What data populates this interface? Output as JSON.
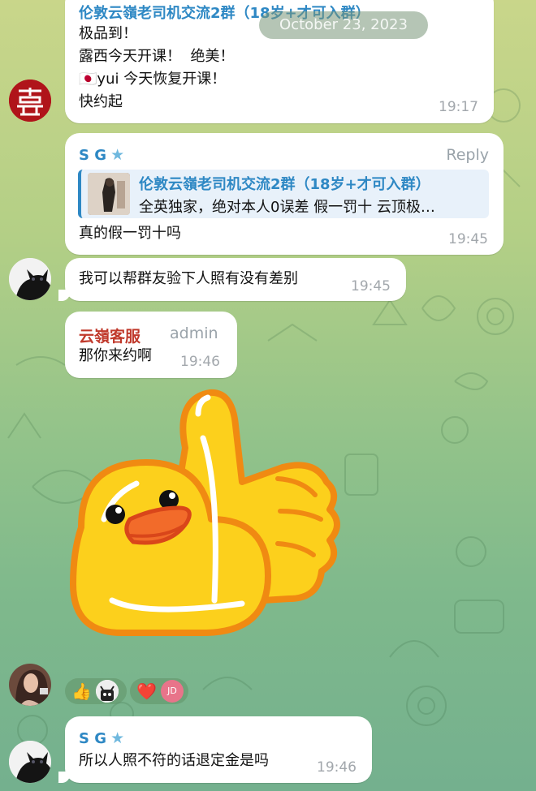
{
  "date_pill": "October 23, 2023",
  "messages": {
    "m1": {
      "sender": "伦敦云嶺老司机交流2群（18岁+才可入群）",
      "lines": [
        "极品到！",
        "露西今天开课！  绝美！",
        "yui 今天恢复开课！",
        "快约起"
      ],
      "flag": "🇯🇵",
      "time": "19:17"
    },
    "m2": {
      "sender": "S G",
      "reply_label": "Reply",
      "quote_title": "伦敦云嶺老司机交流2群（18岁+才可入群）",
      "quote_text": "全英独家，绝对本人0误差 假一罚十 云顶极…",
      "text": "真的假一罚十吗",
      "time": "19:45"
    },
    "m3": {
      "text": "我可以帮群友验下人照有没有差别",
      "time": "19:45"
    },
    "m4": {
      "sender": "云嶺客服",
      "role": "admin",
      "text": "那你来约啊",
      "time": "19:46"
    },
    "m5": {
      "sticker": "duck-thumbs-up",
      "reactions": [
        {
          "emoji": "👍",
          "users": [
            "robot-avatar"
          ]
        },
        {
          "emoji": "❤️",
          "users": [
            "JD"
          ]
        }
      ]
    },
    "m6": {
      "sender": "S G",
      "text": "所以人照不符的话退定金是吗",
      "time": "19:46"
    }
  },
  "colors": {
    "sender_blue": "#2e88c4",
    "admin_red": "#c0392b",
    "time_gray": "#a2a7ac",
    "jd_pink": "#e8748a"
  }
}
